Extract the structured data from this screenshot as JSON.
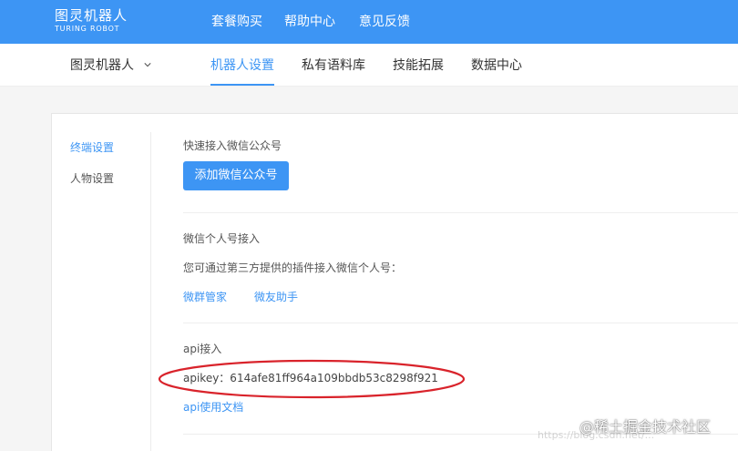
{
  "header": {
    "logo_cn": "图灵机器人",
    "logo_en": "TURING ROBOT",
    "nav": [
      "套餐购买",
      "帮助中心",
      "意见反馈"
    ]
  },
  "subnav": {
    "robot_name": "图灵机器人",
    "tabs": [
      "机器人设置",
      "私有语料库",
      "技能拓展",
      "数据中心"
    ],
    "active_tab": "机器人设置"
  },
  "sidebar": {
    "items": [
      "终端设置",
      "人物设置"
    ],
    "active": "终端设置"
  },
  "main": {
    "wechat_official": {
      "title": "快速接入微信公众号",
      "button": "添加微信公众号"
    },
    "wechat_personal": {
      "title": "微信个人号接入",
      "desc": "您可通过第三方提供的插件接入微信个人号：",
      "links": [
        "微群管家",
        "微友助手"
      ]
    },
    "api": {
      "title": "api接入",
      "apikey": "apikey：614afe81ff964a109bbdb53c8298f921",
      "doc_link": "api使用文档"
    }
  },
  "watermark": {
    "text": "@稀土掘金技术社区",
    "faint_text": "https://blog.csdn.net/..."
  },
  "colors": {
    "primary": "#3d95f4",
    "annotation": "#d9232b"
  }
}
